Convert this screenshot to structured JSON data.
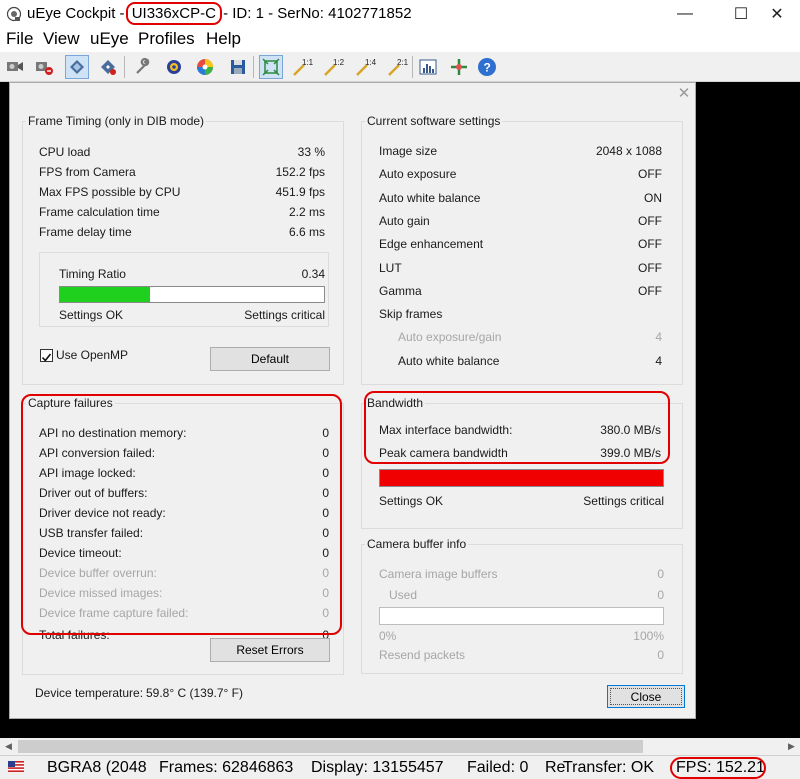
{
  "window": {
    "title_prefix": "uEye Cockpit - ",
    "title_model": "UI336xCP-C",
    "title_suffix": " - ID: 1 - SerNo: 4102771852",
    "minimize_glyph": "—",
    "maximize_glyph": "☐",
    "close_glyph": "✕"
  },
  "menu": [
    "File",
    "View",
    "uEye",
    "Profiles",
    "Help"
  ],
  "toolbar": {
    "icons": [
      "camera-open-icon",
      "camera-close-icon",
      "live-video-icon",
      "snapshot-icon",
      "properties-wrench-icon",
      "settings-gear-icon",
      "color-wheel-icon",
      "save-icon",
      "fit-window-icon",
      "zoom-1-1-icon",
      "zoom-1-2-icon",
      "zoom-1-4-icon",
      "zoom-2-1-icon",
      "histogram-icon",
      "crosshair-icon",
      "help-icon"
    ],
    "zoom_labels": [
      "1:1",
      "1:2",
      "1:4",
      "2:1"
    ]
  },
  "dialog": {
    "close_glyph": "✕",
    "frame_timing": {
      "title": "Frame Timing (only in DIB mode)",
      "rows": [
        {
          "label": "CPU load",
          "value": "33 %"
        },
        {
          "label": "FPS from Camera",
          "value": "152.2 fps"
        },
        {
          "label": "Max FPS possible by CPU",
          "value": "451.9 fps"
        },
        {
          "label": "Frame calculation time",
          "value": "2.2 ms"
        },
        {
          "label": "Frame delay time",
          "value": "6.6 ms"
        }
      ],
      "timing_ratio_label": "Timing Ratio",
      "timing_ratio_value": "0.34",
      "timing_ratio_fraction": 0.34,
      "bar_color": "#1fd01f",
      "settings_ok": "Settings OK",
      "settings_critical": "Settings critical",
      "use_openmp_label": "Use OpenMP",
      "use_openmp_checked": true,
      "default_button": "Default"
    },
    "capture_failures": {
      "title": "Capture failures",
      "rows": [
        {
          "label": "API no destination memory:",
          "value": "0",
          "enabled": true
        },
        {
          "label": "API conversion failed:",
          "value": "0",
          "enabled": true
        },
        {
          "label": "API image locked:",
          "value": "0",
          "enabled": true
        },
        {
          "label": "Driver out of buffers:",
          "value": "0",
          "enabled": true
        },
        {
          "label": "Driver device not ready:",
          "value": "0",
          "enabled": true
        },
        {
          "label": "USB transfer failed:",
          "value": "0",
          "enabled": true
        },
        {
          "label": "Device timeout:",
          "value": "0",
          "enabled": true
        },
        {
          "label": "Device buffer overrun:",
          "value": "0",
          "enabled": false
        },
        {
          "label": "Device missed images:",
          "value": "0",
          "enabled": false
        },
        {
          "label": "Device frame capture failed:",
          "value": "0",
          "enabled": false
        },
        {
          "label": "Total failures:",
          "value": "0",
          "enabled": true
        }
      ],
      "reset_button": "Reset Errors"
    },
    "software_settings": {
      "title": "Current software settings",
      "rows": [
        {
          "label": "Image size",
          "value": "2048 x 1088",
          "indent": false,
          "enabled": true
        },
        {
          "label": "Auto exposure",
          "value": "OFF",
          "indent": false,
          "enabled": true
        },
        {
          "label": "Auto white balance",
          "value": "ON",
          "indent": false,
          "enabled": true
        },
        {
          "label": "Auto gain",
          "value": "OFF",
          "indent": false,
          "enabled": true
        },
        {
          "label": "Edge enhancement",
          "value": "OFF",
          "indent": false,
          "enabled": true
        },
        {
          "label": "LUT",
          "value": "OFF",
          "indent": false,
          "enabled": true
        },
        {
          "label": "Gamma",
          "value": "OFF",
          "indent": false,
          "enabled": true
        },
        {
          "label": "Skip frames",
          "value": "",
          "indent": false,
          "enabled": true
        },
        {
          "label": "Auto exposure/gain",
          "value": "4",
          "indent": true,
          "enabled": false
        },
        {
          "label": "Auto white balance",
          "value": "4",
          "indent": true,
          "enabled": true
        }
      ]
    },
    "bandwidth": {
      "title": "Bandwidth",
      "rows": [
        {
          "label": "Max interface bandwidth:",
          "value": "380.0 MB/s"
        },
        {
          "label": "Peak camera bandwidth",
          "value": "399.0 MB/s"
        }
      ],
      "bar_fraction": 1.0,
      "bar_color": "#f00000",
      "settings_ok": "Settings OK",
      "settings_critical": "Settings critical"
    },
    "camera_buffer": {
      "title": "Camera buffer info",
      "image_buffers_label": "Camera image buffers",
      "image_buffers_value": "0",
      "used_label": "Used",
      "used_value": "0",
      "bar_fraction": 0,
      "min_label": "0%",
      "max_label": "100%",
      "resend_label": "Resend packets",
      "resend_value": "0"
    },
    "device_temperature_label": "Device temperature:",
    "device_temperature_value": "59.8° C (139.7° F)",
    "close_button": "Close"
  },
  "statusbar": {
    "format": "BGRA8 (2048",
    "frames": "Frames: 62846863",
    "display": "Display: 13155457",
    "failed": "Failed: 0",
    "re": "Re",
    "transfer": "Transfer: OK",
    "fps": "FPS: 152.21"
  },
  "colors": {
    "highlight_ring": "#e00000",
    "ratio_bar": "#1fd01f",
    "bandwidth_bar": "#f00000"
  }
}
